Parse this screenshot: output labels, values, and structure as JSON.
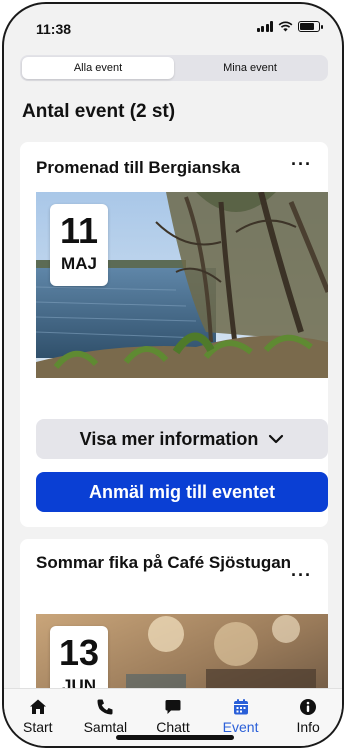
{
  "status_bar": {
    "time": "11:38"
  },
  "segmented_control": {
    "options": [
      "Alla event",
      "Mina event"
    ],
    "selected": "Alla event"
  },
  "events_header": {
    "title": "Antal event (2 st)"
  },
  "events": [
    {
      "title": "Promenad till Bergianska",
      "day": "11",
      "month": "MAJ",
      "more_info_label": "Visa mer information",
      "signup_label": "Anmäl mig till eventet"
    },
    {
      "title": "Sommar fika på Café Sjöstugan",
      "day": "13",
      "month": "JUN"
    }
  ],
  "card_menu": {
    "glyph": "···"
  },
  "tabbar": {
    "items": [
      {
        "label": "Start",
        "icon": "home-icon"
      },
      {
        "label": "Samtal",
        "icon": "phone-icon"
      },
      {
        "label": "Chatt",
        "icon": "chat-bubble-icon"
      },
      {
        "label": "Event",
        "icon": "calendar-icon"
      },
      {
        "label": "Info",
        "icon": "info-icon"
      }
    ],
    "active": "Event"
  },
  "colors": {
    "accent_blue": "#0a3fd4",
    "active_tab": "#2a5fd8",
    "background": "#f2f2f2"
  }
}
